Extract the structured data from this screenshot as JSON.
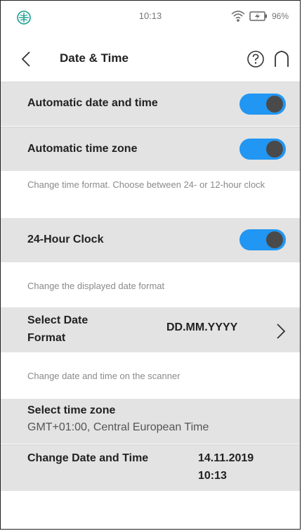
{
  "status_bar": {
    "time": "10:13",
    "battery": "96%",
    "logo_icon": "crosshair-globe-icon",
    "wifi_icon": "wifi-icon",
    "battery_icon": "battery-charging-icon"
  },
  "header": {
    "title": "Date & Time",
    "back_icon": "chevron-left-icon",
    "help_icon": "help-circle-icon",
    "home_icon": "home-icon"
  },
  "colors": {
    "toggle_on": "#2196f3",
    "row_gray": "#e3e3e3",
    "description_text": "#8a8a8a"
  },
  "settings": {
    "auto_date_time": {
      "label": "Automatic date and time",
      "enabled": true
    },
    "auto_time_zone": {
      "label": "Automatic time zone",
      "enabled": true
    },
    "time_format_description": "Change time format. Choose between 24- or 12-hour clock",
    "clock_24h": {
      "label": "24-Hour Clock",
      "enabled": true
    },
    "date_format_description": "Change the displayed date format",
    "date_format": {
      "label": "Select Date Format",
      "value": "DD.MM.YYYY"
    },
    "date_time_description": "Change date and time on the scanner",
    "time_zone": {
      "label": "Select time zone",
      "value": "GMT+01:00, Central European Time"
    },
    "change_date_time": {
      "label": "Change Date and Time",
      "date": "14.11.2019",
      "time": "10:13"
    }
  }
}
